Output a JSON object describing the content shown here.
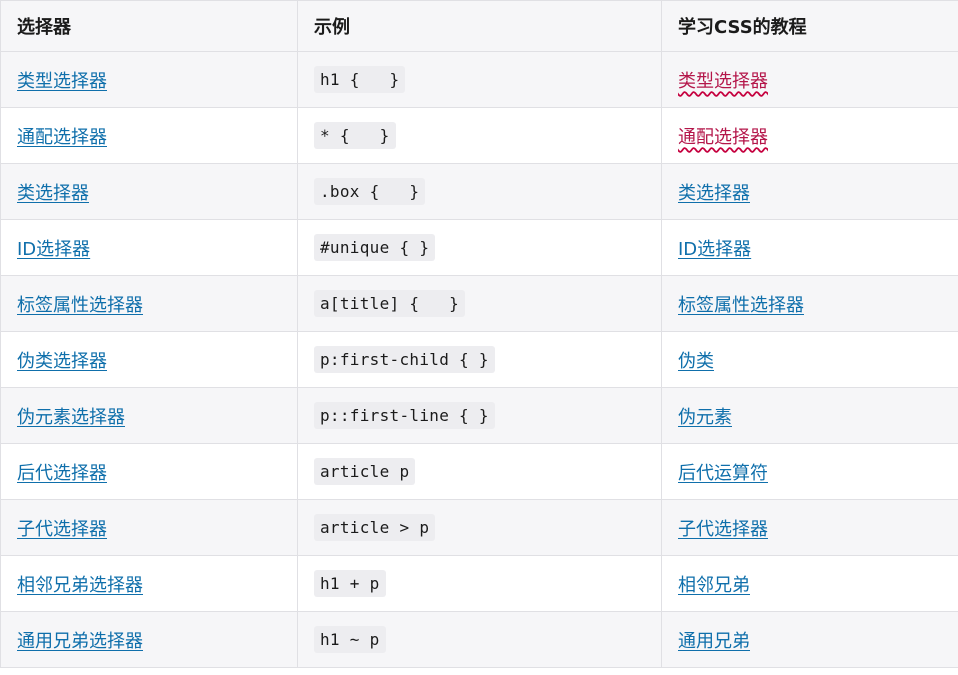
{
  "headers": [
    "选择器",
    "示例",
    "学习CSS的教程"
  ],
  "rows": [
    {
      "selector": "类型选择器",
      "example": "h1 {   }",
      "tutorial": "类型选择器"
    },
    {
      "selector": "通配选择器",
      "example": "* {   }",
      "tutorial": "通配选择器"
    },
    {
      "selector": "类选择器",
      "example": ".box {   }",
      "tutorial": "类选择器"
    },
    {
      "selector": "ID选择器",
      "example": "#unique { }",
      "tutorial": "ID选择器"
    },
    {
      "selector": "标签属性选择器",
      "example": "a[title] {   }",
      "tutorial": "标签属性选择器"
    },
    {
      "selector": "伪类选择器",
      "example": "p:first-child { }",
      "tutorial": "伪类"
    },
    {
      "selector": "伪元素选择器",
      "example": "p::first-line { }",
      "tutorial": "伪元素"
    },
    {
      "selector": "后代选择器",
      "example": "article p",
      "tutorial": "后代运算符"
    },
    {
      "selector": "子代选择器",
      "example": "article > p",
      "tutorial": "子代选择器"
    },
    {
      "selector": "相邻兄弟选择器",
      "example": "h1 + p",
      "tutorial": "相邻兄弟"
    },
    {
      "selector": "通用兄弟选择器",
      "example": "h1 ~ p",
      "tutorial": "通用兄弟"
    }
  ],
  "colors": {
    "link": "#0f6fab",
    "link_misspelled": "#b4164a",
    "row_alt_bg": "#f6f6f8",
    "code_bg": "#ededf0",
    "border": "#e0e0e4"
  }
}
